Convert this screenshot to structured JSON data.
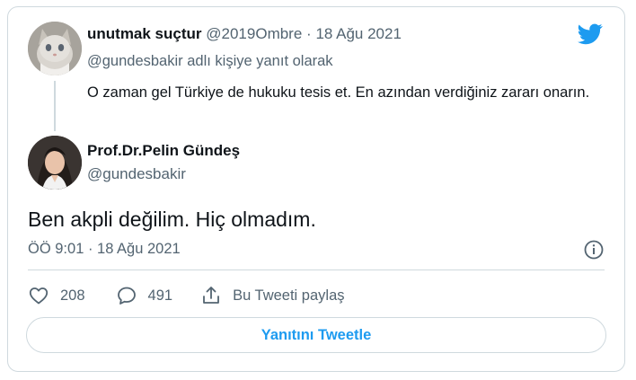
{
  "reply": {
    "name": "unutmak suçtur",
    "handle": "@2019Ombre",
    "separator": "·",
    "date": "18 Ağu 2021",
    "reply_to": "@gundesbakir adlı kişiye yanıt olarak",
    "text": "O zaman gel Türkiye de hukuku tesis et. En azından verdiğiniz zararı onarın."
  },
  "tweet": {
    "author_name": "Prof.Dr.Pelin Gündeş",
    "author_handle": "@gundesbakir",
    "text": "Ben akpli değilim. Hiç olmadım.",
    "timestamp": "ÖÖ 9:01 · 18 Ağu 2021"
  },
  "actions": {
    "likes": "208",
    "replies": "491",
    "share_label": "Bu Tweeti paylaş"
  },
  "reply_button_label": "Yanıtını Tweetle",
  "colors": {
    "brand": "#1d9bf0",
    "text": "#0f1419",
    "secondary_text": "#536471",
    "border": "#cfd9de"
  },
  "icons": [
    "twitter-bird-icon",
    "info-icon",
    "heart-icon",
    "reply-icon",
    "share-icon"
  ]
}
